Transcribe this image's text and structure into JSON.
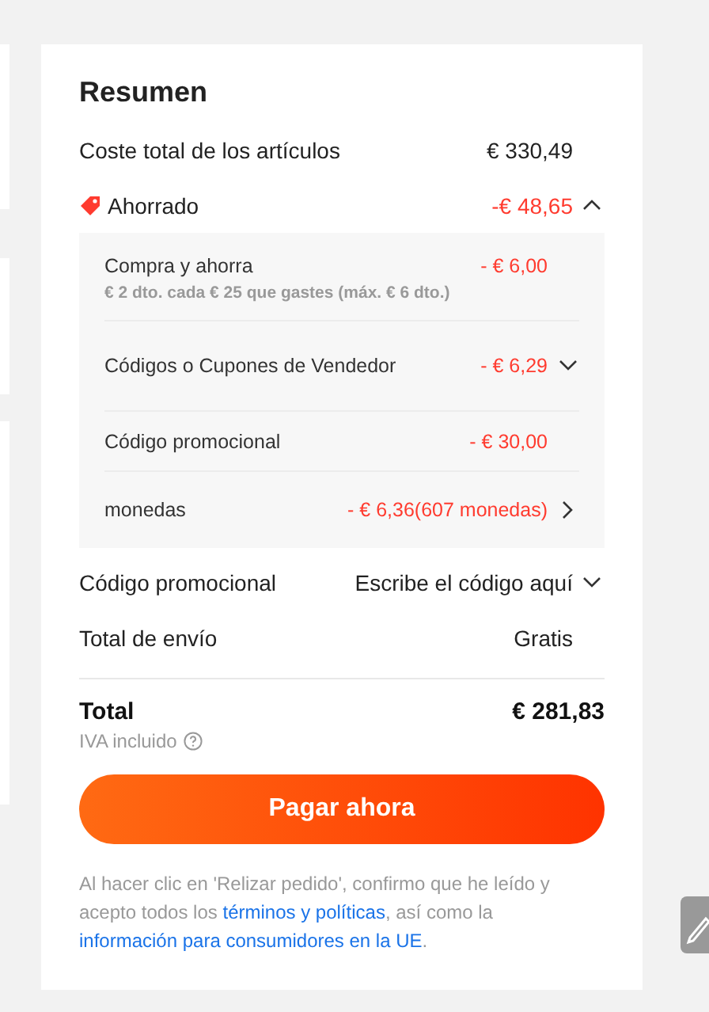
{
  "summary": {
    "title": "Resumen",
    "rows_top": [
      {
        "label": "Coste total de los artículos",
        "value": "€ 330,49"
      }
    ],
    "savings": {
      "label": "Ahorrado",
      "value": "-€ 48,65",
      "expanded": true,
      "items": [
        {
          "label": "Compra y ahorra",
          "value": "- € 6,00",
          "note": "€ 2 dto. cada € 25 que gastes (máx. € 6 dto.)",
          "kind": "plain"
        },
        {
          "label": "Códigos o Cupones de Vendedor",
          "value": "- € 6,29",
          "kind": "dropdown"
        },
        {
          "label": "Código promocional",
          "value": "- € 30,00",
          "kind": "plain"
        },
        {
          "label": "monedas",
          "value": "- € 6,36(607 monedas)",
          "kind": "link"
        }
      ]
    },
    "promo": {
      "label": "Código promocional",
      "placeholder": "Escribe el código aquí"
    },
    "shipping": {
      "label": "Total de envío",
      "value": "Gratis"
    },
    "total": {
      "label": "Total",
      "value": "€ 281,83",
      "tax_note": "IVA incluido"
    },
    "pay_button": "Pagar ahora",
    "legal": [
      {
        "kind": "text",
        "text": "Al hacer clic en 'Relizar pedido', confirmo que he leído y acepto todos los "
      },
      {
        "kind": "link",
        "text": "términos y políticas"
      },
      {
        "kind": "text",
        "text": ", así como la "
      },
      {
        "kind": "link",
        "text": "información para consumidores en la UE"
      },
      {
        "kind": "text",
        "text": "."
      }
    ]
  }
}
